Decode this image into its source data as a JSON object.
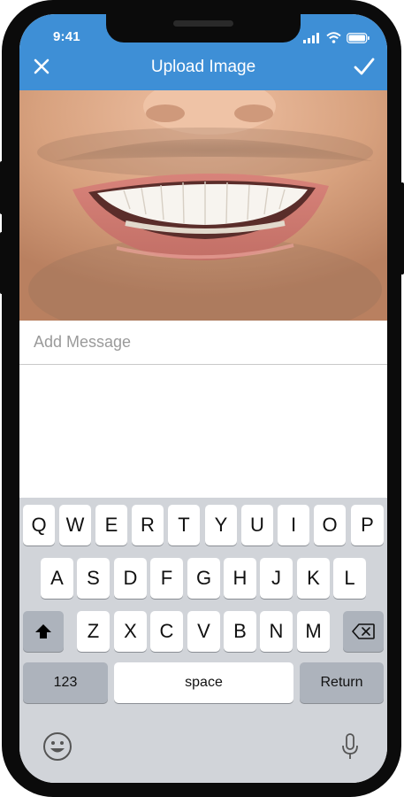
{
  "status_bar": {
    "time": "9:41"
  },
  "header": {
    "title": "Upload Image",
    "close_icon": "close-icon",
    "confirm_icon": "checkmark-icon",
    "background": "#3e8fd6"
  },
  "message": {
    "placeholder": "Add Message",
    "value": ""
  },
  "keyboard": {
    "row1": [
      "Q",
      "W",
      "E",
      "R",
      "T",
      "Y",
      "U",
      "I",
      "O",
      "P"
    ],
    "row2": [
      "A",
      "S",
      "D",
      "F",
      "G",
      "H",
      "J",
      "K",
      "L"
    ],
    "row3": [
      "Z",
      "X",
      "C",
      "V",
      "B",
      "N",
      "M"
    ],
    "shift_icon": "shift-icon",
    "delete_icon": "backspace-icon",
    "numbers_label": "123",
    "space_label": "space",
    "return_label": "Return",
    "emoji_icon": "emoji-icon",
    "mic_icon": "microphone-icon"
  }
}
